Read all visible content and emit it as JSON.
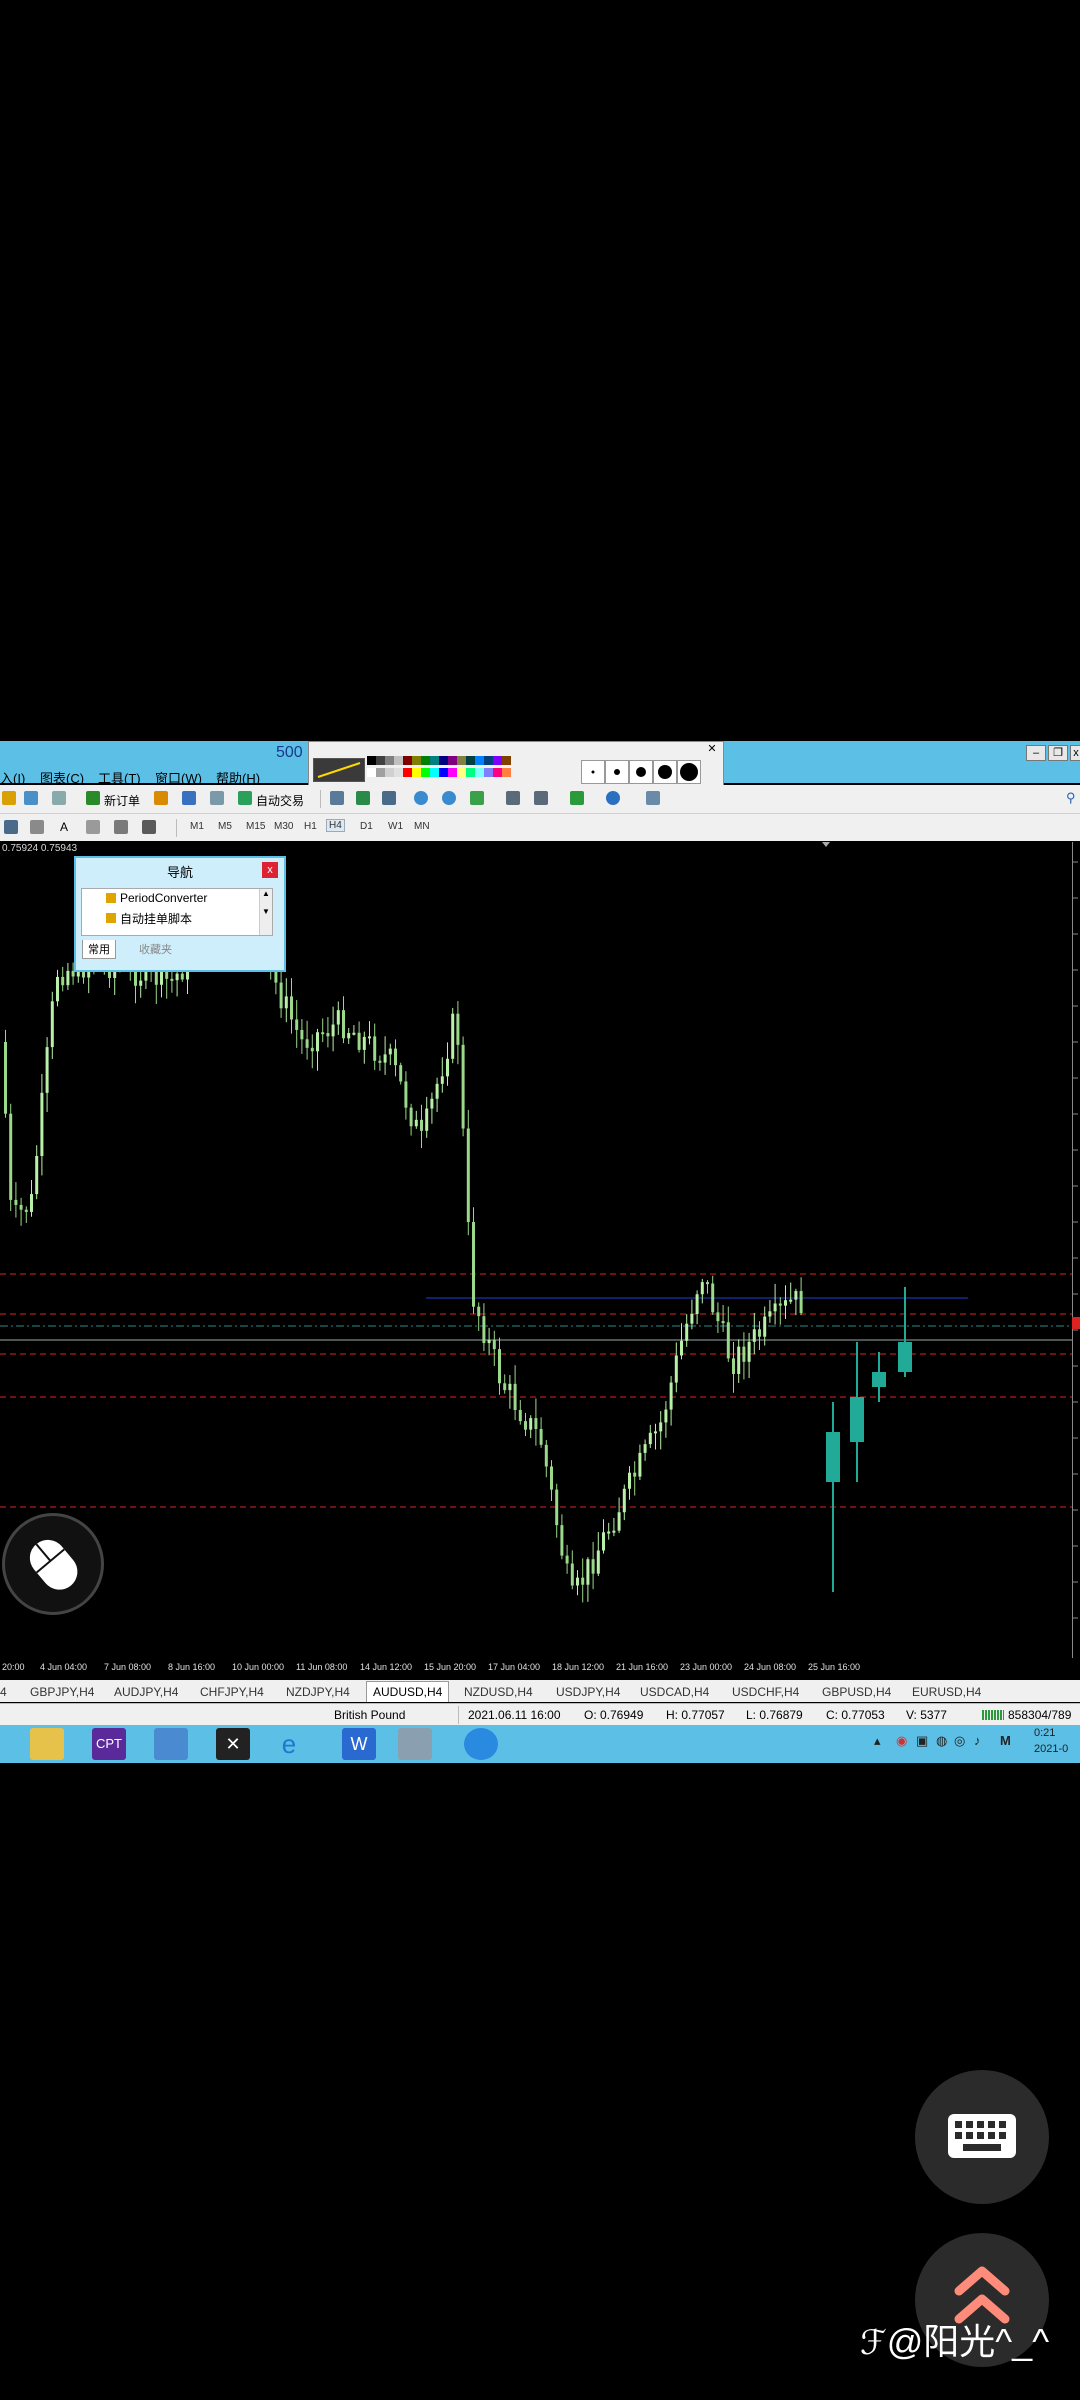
{
  "menubar": {
    "items": [
      "入(I)",
      "图表(C)",
      "工具(T)",
      "窗口(W)",
      "帮助(H)"
    ],
    "badge": "500"
  },
  "toolbar": {
    "new_order_label": "新订单",
    "auto_trade_label": "自动交易",
    "timeframes": [
      "M1",
      "M5",
      "M15",
      "M30",
      "H1",
      "H4",
      "D1",
      "W1",
      "MN"
    ],
    "selected_timeframe": "H4"
  },
  "chart": {
    "price_label": "0.75924 0.75943",
    "time_labels": [
      "20:00",
      "4 Jun 04:00",
      "7 Jun 08:00",
      "8 Jun 16:00",
      "10 Jun 00:00",
      "11 Jun 08:00",
      "14 Jun 12:00",
      "15 Jun 20:00",
      "17 Jun 04:00",
      "18 Jun 12:00",
      "21 Jun 16:00",
      "23 Jun 00:00",
      "24 Jun 08:00",
      "25 Jun 16:00"
    ],
    "bull_color": "#b8f0a8",
    "bear_color": "#22aa99"
  },
  "navigator": {
    "title": "导航",
    "close": "x",
    "items": [
      "PeriodConverter",
      "自动挂单脚本"
    ],
    "tabs": [
      "常用",
      "收藏夹"
    ]
  },
  "symbol_tabs": {
    "items": [
      "4",
      "GBPJPY,H4",
      "AUDJPY,H4",
      "CHFJPY,H4",
      "NZDJPY,H4",
      "AUDUSD,H4",
      "NZDUSD,H4",
      "USDJPY,H4",
      "USDCAD,H4",
      "USDCHF,H4",
      "GBPUSD,H4",
      "EURUSD,H4"
    ],
    "selected": "AUDUSD,H4"
  },
  "status": {
    "symbol_name": "British Pound",
    "datetime": "2021.06.11 16:00",
    "open": "O: 0.76949",
    "high": "H: 0.77057",
    "low": "L: 0.76879",
    "close": "C: 0.77053",
    "volume": "V: 5377",
    "traffic": "858304/789"
  },
  "taskbar": {
    "tray_letter": "M",
    "clock_time": "0:21",
    "clock_date": "2021-0"
  },
  "watermark": "@阳光^_^"
}
